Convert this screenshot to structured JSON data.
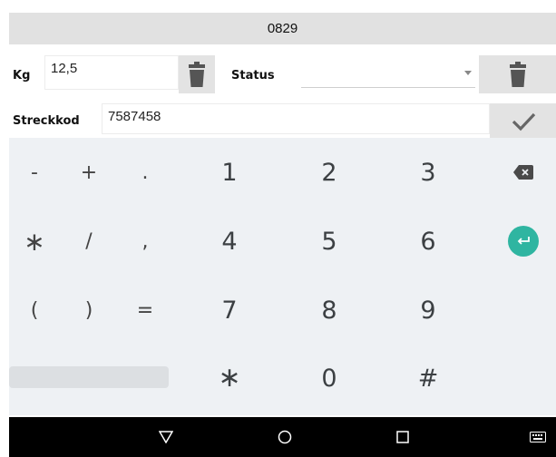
{
  "header": {
    "title": "0829"
  },
  "kg": {
    "label": "Kg",
    "value": "12,5"
  },
  "status": {
    "label": "Status",
    "selected": ""
  },
  "barcode": {
    "label": "Streckkod",
    "value": "7587458"
  },
  "keyboard": {
    "rows": [
      [
        "-",
        "+",
        ".",
        "1",
        "2",
        "3"
      ],
      [
        "∗",
        "/",
        ",",
        "4",
        "5",
        "6"
      ],
      [
        "(",
        ")",
        "=",
        "7",
        "8",
        "9"
      ],
      [
        "∗",
        "0",
        "#"
      ]
    ],
    "accent_color": "#2fb5a1"
  },
  "navbar": {
    "icons": [
      "back-icon",
      "home-icon",
      "recents-icon",
      "keyboard-icon"
    ]
  }
}
